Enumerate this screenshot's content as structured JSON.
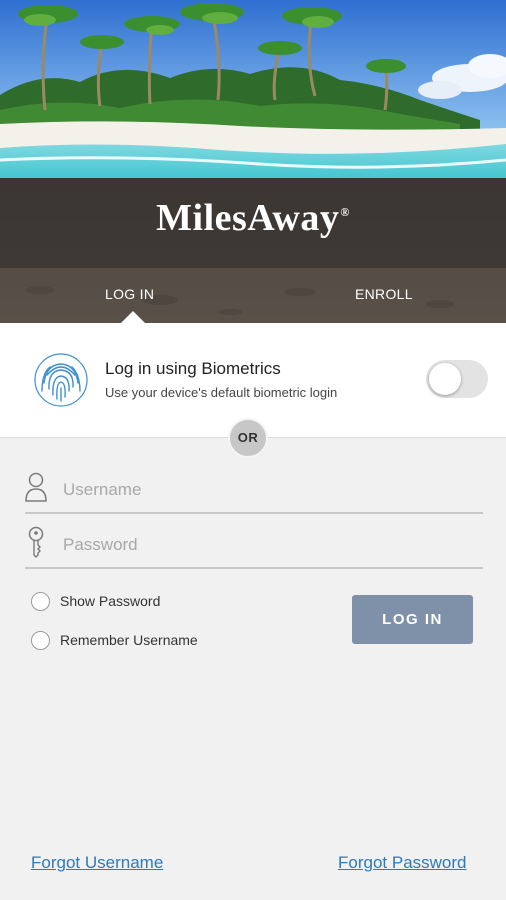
{
  "brand": {
    "logo_text": "MilesAway",
    "logo_mark": "®"
  },
  "tabs": [
    {
      "label": "LOG IN",
      "active": true
    },
    {
      "label": "ENROLL",
      "active": false
    }
  ],
  "biometrics": {
    "title": "Log in using Biometrics",
    "subtitle": "Use your device's default biometric login",
    "icon": "fingerprint-icon",
    "toggle_on": false
  },
  "divider": {
    "label": "OR"
  },
  "form": {
    "username": {
      "placeholder": "Username",
      "value": "",
      "icon": "user-icon"
    },
    "password": {
      "placeholder": "Password",
      "value": "",
      "icon": "key-icon"
    },
    "show_password": {
      "label": "Show Password",
      "checked": false
    },
    "remember_username": {
      "label": "Remember Username",
      "checked": false
    },
    "submit_label": "LOG IN"
  },
  "links": {
    "forgot_username": "Forgot Username",
    "forgot_password": "Forgot Password"
  },
  "colors": {
    "accent_button": "#7f91a8",
    "link": "#2b7bbd",
    "fingerprint": "#3d8fd1",
    "brand_band": "#302b28"
  }
}
